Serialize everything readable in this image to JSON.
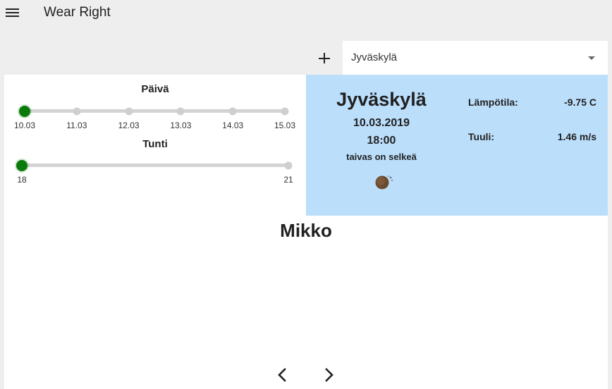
{
  "app": {
    "title": "Wear Right"
  },
  "location": {
    "selected": "Jyväskylä"
  },
  "sliders": {
    "day": {
      "title": "Päivä",
      "marks": [
        "10.03",
        "11.03",
        "12.03",
        "13.03",
        "14.03",
        "15.03"
      ],
      "selected_index": 0
    },
    "hour": {
      "title": "Tunti",
      "marks": [
        "18",
        "21"
      ],
      "selected_index": 0
    }
  },
  "weather": {
    "city": "Jyväskylä",
    "date": "10.03.2019",
    "time": "18:00",
    "description": "taivas on selkeä",
    "icon": "clear-night-moon-icon",
    "temperature_label": "Lämpötila:",
    "temperature_value": "-9.75 C",
    "wind_label": "Tuuli:",
    "wind_value": "1.46 m/s"
  },
  "person": {
    "name": "Mikko"
  },
  "colors": {
    "accent": "#0a7a0a",
    "weather_panel": "#bbdefb",
    "background": "#eeeeee"
  }
}
